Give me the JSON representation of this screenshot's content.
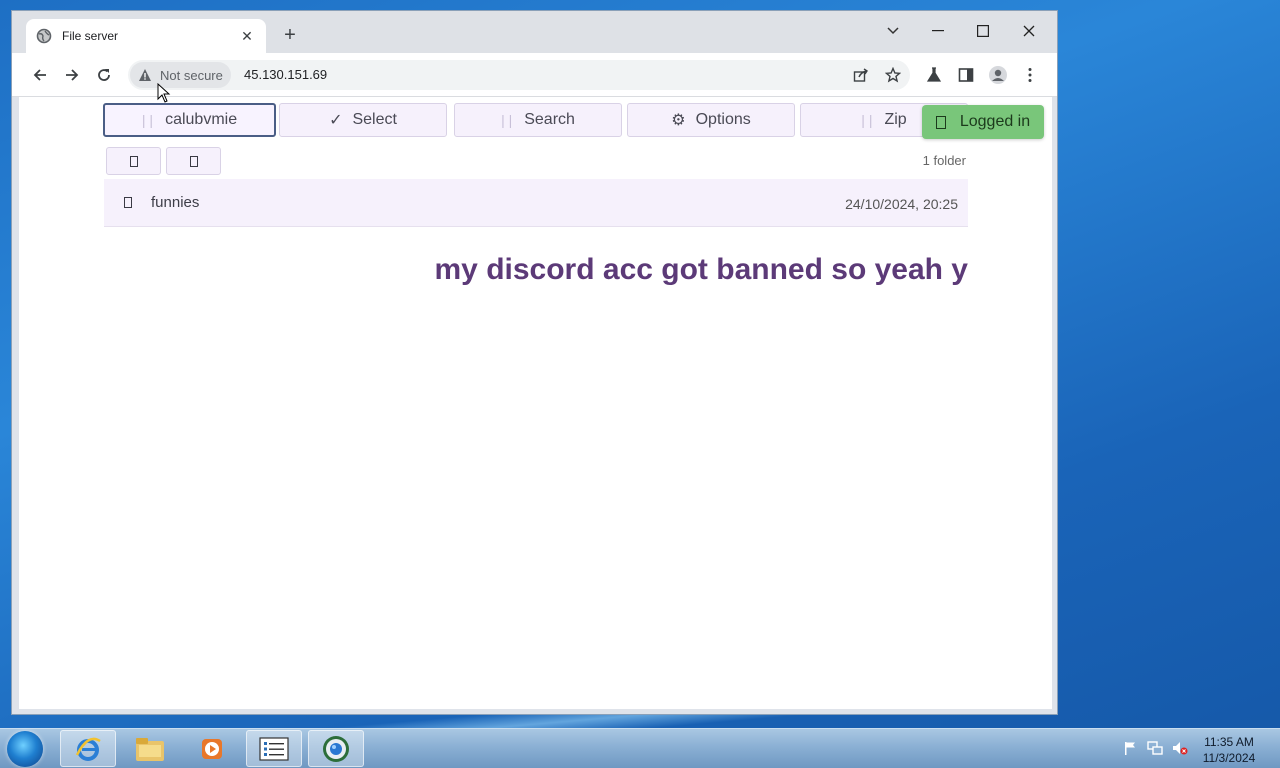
{
  "browser": {
    "tab_title": "File server",
    "security_label": "Not secure",
    "url": "45.130.151.69"
  },
  "page": {
    "toolbar": {
      "user_label": "calubvmie",
      "select_label": "Select",
      "search_label": "Search",
      "options_label": "Options",
      "zip_label": "Zip",
      "status_label": "Logged in"
    },
    "folder_count": "1 folder",
    "rows": [
      {
        "name": "funnies",
        "date": "24/10/2024, 20:25"
      }
    ],
    "banner": "my discord acc got banned so yeah y"
  },
  "taskbar": {
    "time": "11:35 AM",
    "date": "11/3/2024"
  },
  "colors": {
    "accent_purple": "#5c3a78",
    "logged_in_green": "#79c67a",
    "button_bg": "#f6f1fc"
  }
}
